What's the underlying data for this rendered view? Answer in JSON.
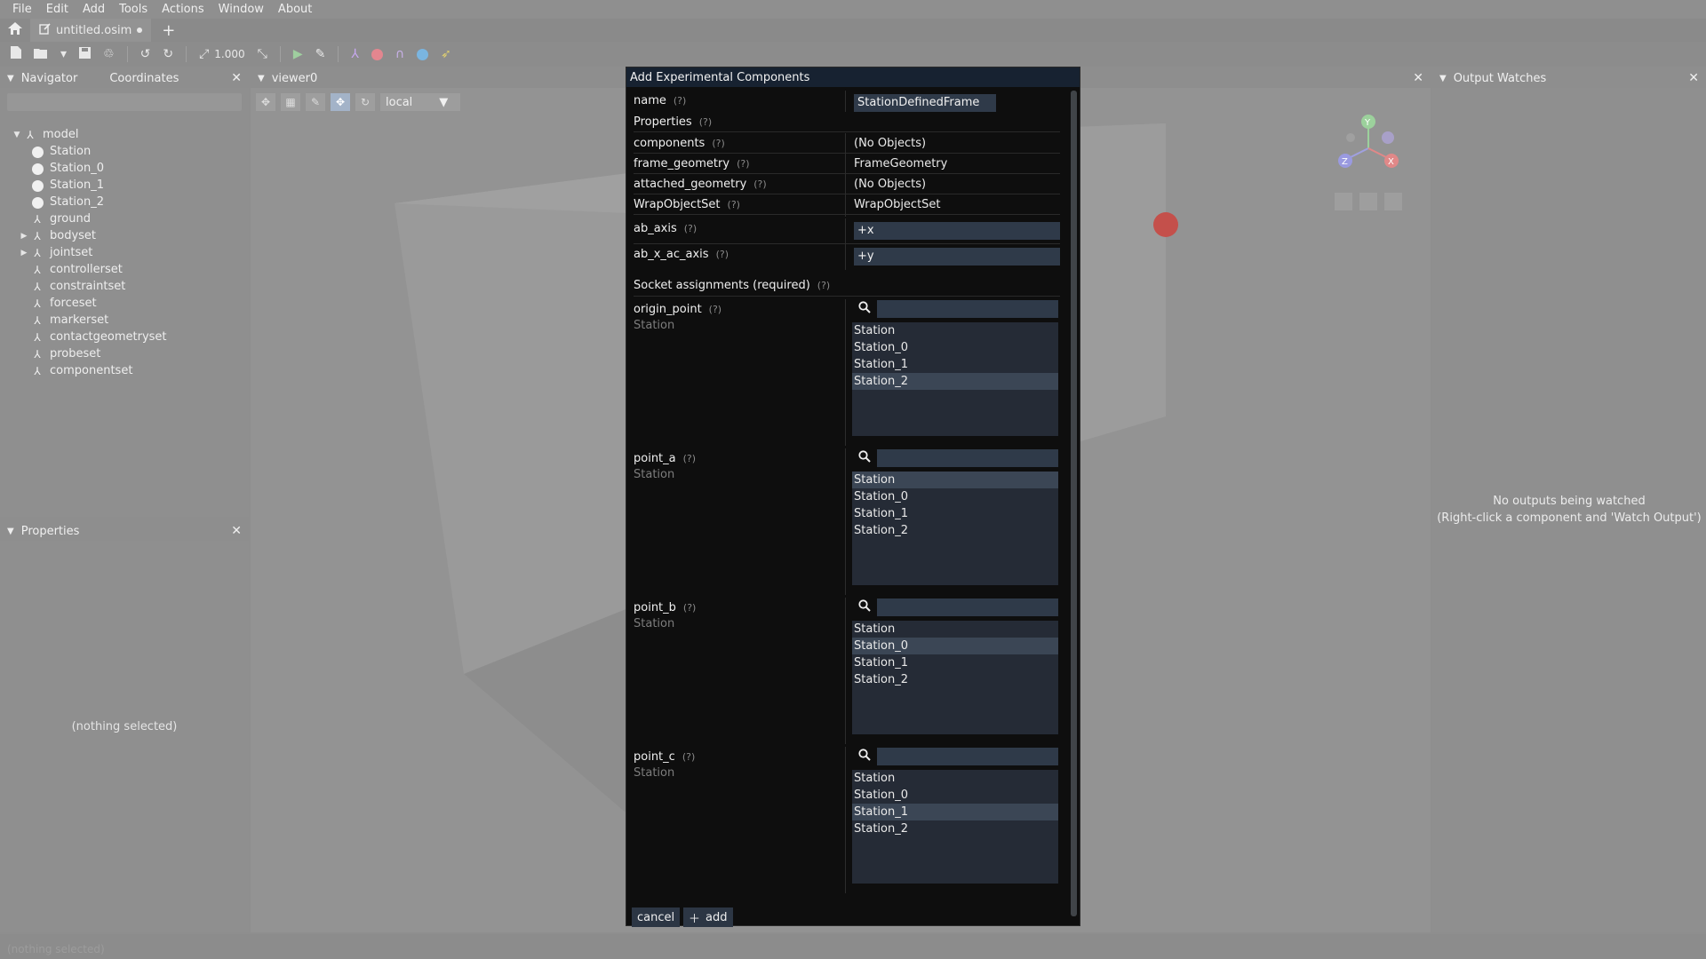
{
  "menu": [
    "File",
    "Edit",
    "Add",
    "Tools",
    "Actions",
    "Window",
    "About"
  ],
  "tab": {
    "filename": "untitled.osim"
  },
  "toolbar": {
    "zoom": "1.000"
  },
  "navigator": {
    "title": "Navigator",
    "tab2": "Coordinates",
    "tree": [
      {
        "label": "model",
        "kind": "root",
        "expand": "open"
      },
      {
        "label": "Station",
        "kind": "station"
      },
      {
        "label": "Station_0",
        "kind": "station"
      },
      {
        "label": "Station_1",
        "kind": "station"
      },
      {
        "label": "Station_2",
        "kind": "station"
      },
      {
        "label": "ground",
        "kind": "frame"
      },
      {
        "label": "bodyset",
        "kind": "set",
        "expand": "closed"
      },
      {
        "label": "jointset",
        "kind": "set",
        "expand": "closed"
      },
      {
        "label": "controllerset",
        "kind": "set"
      },
      {
        "label": "constraintset",
        "kind": "set"
      },
      {
        "label": "forceset",
        "kind": "set"
      },
      {
        "label": "markerset",
        "kind": "set"
      },
      {
        "label": "contactgeometryset",
        "kind": "set"
      },
      {
        "label": "probeset",
        "kind": "set"
      },
      {
        "label": "componentset",
        "kind": "set"
      }
    ]
  },
  "properties": {
    "title": "Properties",
    "empty": "(nothing selected)"
  },
  "viewer": {
    "title": "viewer0",
    "frame_mode": "local"
  },
  "output": {
    "title": "Output Watches",
    "empty_line1": "No outputs being watched",
    "empty_line2": "(Right-click a component and 'Watch Output')"
  },
  "status": {
    "text": "(nothing selected)"
  },
  "dialog": {
    "title": "Add Experimental Components",
    "name_label": "name",
    "name_value": "StationDefinedFrame",
    "properties_header": "Properties",
    "help": "(?)",
    "props": [
      {
        "label": "components",
        "value": "(No Objects)"
      },
      {
        "label": "frame_geometry",
        "value": "FrameGeometry"
      },
      {
        "label": "attached_geometry",
        "value": "(No Objects)"
      },
      {
        "label": "WrapObjectSet",
        "value": "WrapObjectSet"
      }
    ],
    "ab_axis": {
      "label": "ab_axis",
      "value": "+x"
    },
    "ab_x_ac_axis": {
      "label": "ab_x_ac_axis",
      "value": "+y"
    },
    "sockets_header": "Socket assignments (required)",
    "sockets": [
      {
        "label": "origin_point",
        "type": "Station",
        "options": [
          "Station",
          "Station_0",
          "Station_1",
          "Station_2"
        ],
        "selected": 3
      },
      {
        "label": "point_a",
        "type": "Station",
        "options": [
          "Station",
          "Station_0",
          "Station_1",
          "Station_2"
        ],
        "selected": 0
      },
      {
        "label": "point_b",
        "type": "Station",
        "options": [
          "Station",
          "Station_0",
          "Station_1",
          "Station_2"
        ],
        "selected": 1
      },
      {
        "label": "point_c",
        "type": "Station",
        "options": [
          "Station",
          "Station_0",
          "Station_1",
          "Station_2"
        ],
        "selected": 2
      }
    ],
    "cancel_label": "cancel",
    "add_label": "add"
  }
}
